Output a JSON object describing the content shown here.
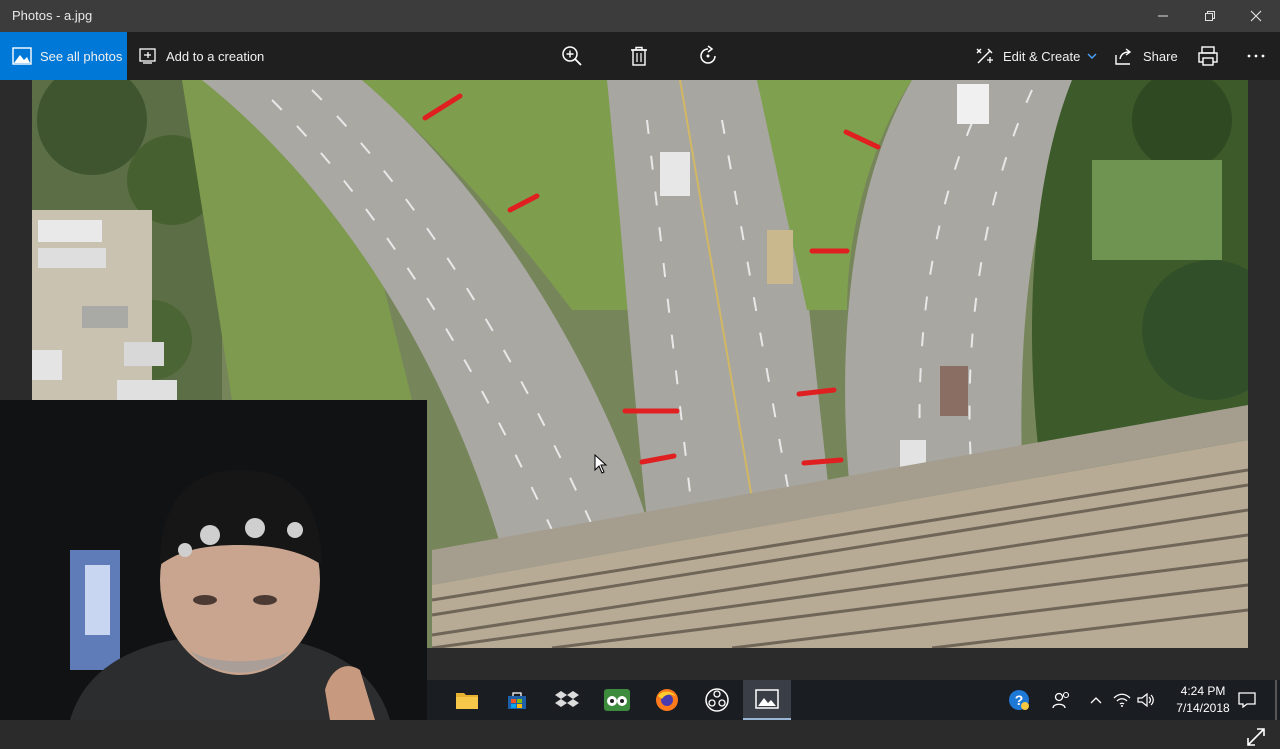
{
  "window": {
    "title": "Photos - a.jpg"
  },
  "toolbar": {
    "see_all_label": "See all photos",
    "add_creation_label": "Add to a creation",
    "edit_create_label": "Edit & Create",
    "share_label": "Share"
  },
  "taskbar": {
    "apps": [
      "file-explorer",
      "store",
      "dropbox",
      "tripadvisor",
      "firefox",
      "obs",
      "photos"
    ],
    "clock_time": "4:24 PM",
    "clock_date": "7/14/2018"
  },
  "colors": {
    "accent": "#0078d7",
    "annotation": "#e02020",
    "titlebar": "#3c3c3c",
    "toolbar": "#1f1f1f"
  }
}
